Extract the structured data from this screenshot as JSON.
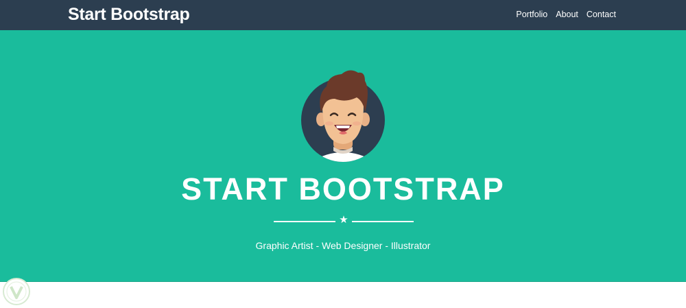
{
  "navbar": {
    "brand": "Start Bootstrap",
    "links": [
      {
        "label": "Portfolio"
      },
      {
        "label": "About"
      },
      {
        "label": "Contact"
      }
    ]
  },
  "hero": {
    "title": "START BOOTSTRAP",
    "subtitle": "Graphic Artist - Web Designer - Illustrator",
    "avatar_icon": "profile-avatar-icon",
    "divider_icon": "star-icon"
  },
  "colors": {
    "navbar": "#2c3e50",
    "hero": "#1abc9c",
    "text": "#ffffff"
  }
}
